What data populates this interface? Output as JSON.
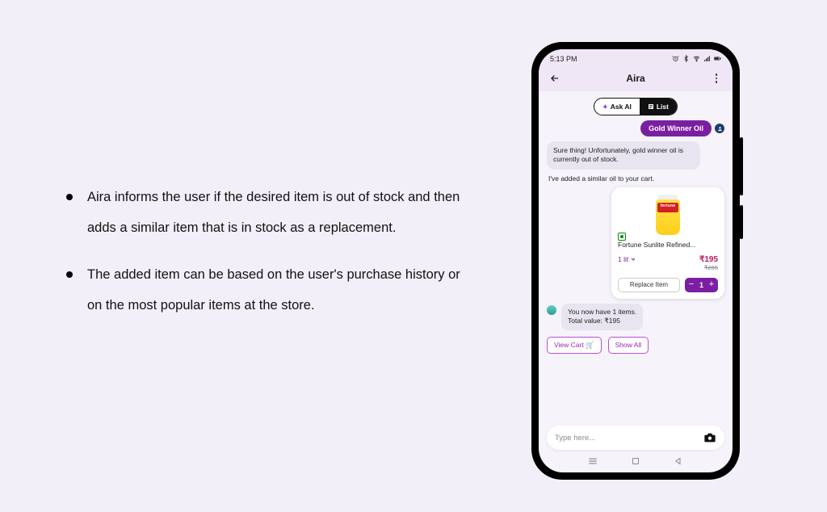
{
  "bullets": [
    "Aira informs the user if the desired item is out of stock and then adds a similar item that is in stock as a replacement.",
    "The added item can be based on the user's purchase history or on the most popular items at the store."
  ],
  "statusbar": {
    "time": "5:13 PM"
  },
  "header": {
    "title": "Aira"
  },
  "segment": {
    "ask_label": "Ask AI",
    "list_label": "List"
  },
  "chat": {
    "user_msg": "Gold Winner Oil",
    "bot_msg_1": "Sure thing! Unfortunately, gold winner oil is currently out of stock.",
    "bot_msg_2": "I've added a similar oil to your cart."
  },
  "product": {
    "brand_on_pack": "fortune",
    "name": "Fortune Sunlite Refined...",
    "unit": "1 lit",
    "price": "₹195",
    "mrp": "₹265",
    "replace_label": "Replace Item",
    "qty": "1"
  },
  "summary": {
    "line1": "You now have 1 items.",
    "line2": "Total value: ₹195",
    "view_cart": "View Cart 🛒",
    "show_all": "Show All"
  },
  "input": {
    "placeholder": "Type here..."
  }
}
